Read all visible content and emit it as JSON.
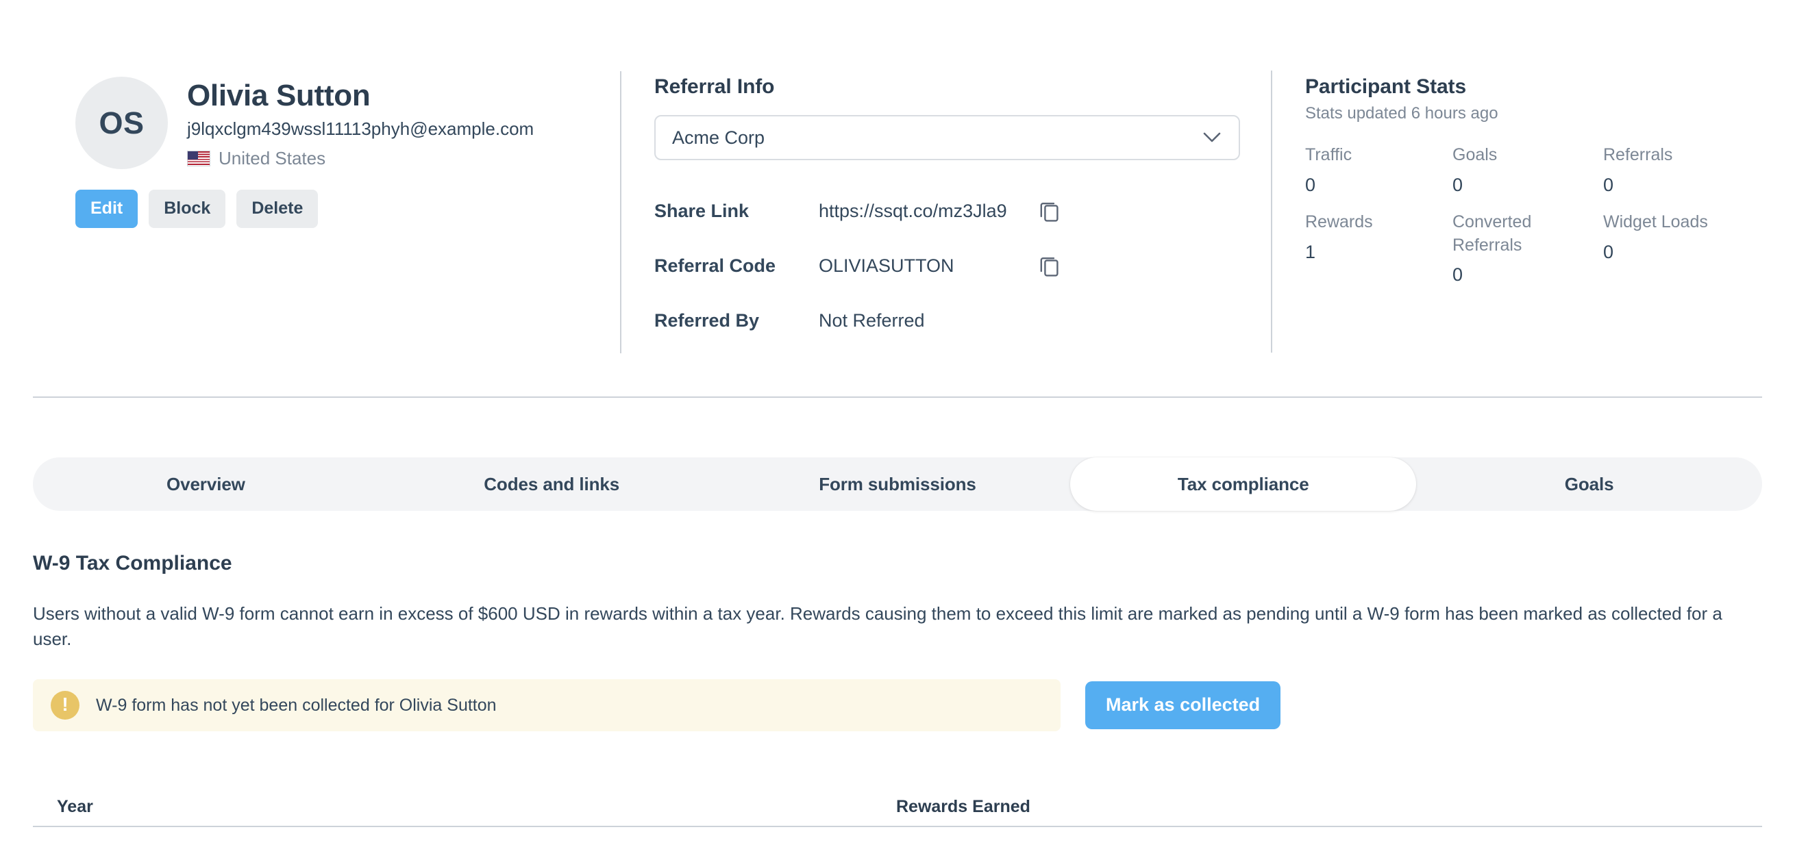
{
  "profile": {
    "initials": "OS",
    "name": "Olivia Sutton",
    "email": "j9lqxclgm439wssl11113phyh@example.com",
    "country": "United States",
    "flag": "🇺🇸",
    "buttons": {
      "edit": "Edit",
      "block": "Block",
      "delete": "Delete"
    }
  },
  "referral_info": {
    "title": "Referral Info",
    "program_select": {
      "value": "Acme Corp",
      "icon": "chevron-down-icon"
    },
    "rows": [
      {
        "label": "Share Link",
        "value": "https://ssqt.co/mz3Jla9",
        "copyable": true,
        "icon": "copy-icon"
      },
      {
        "label": "Referral Code",
        "value": "OLIVIASUTTON",
        "copyable": true,
        "icon": "copy-icon"
      },
      {
        "label": "Referred By",
        "value": "Not Referred",
        "copyable": false
      }
    ]
  },
  "participant_stats": {
    "title": "Participant Stats",
    "subtitle": "Stats updated 6 hours ago",
    "items": [
      {
        "label": "Traffic",
        "value": "0"
      },
      {
        "label": "Goals",
        "value": "0"
      },
      {
        "label": "Referrals",
        "value": "0"
      },
      {
        "label": "Rewards",
        "value": "1"
      },
      {
        "label": "Converted Referrals",
        "value": "0"
      },
      {
        "label": "Widget Loads",
        "value": "0"
      }
    ]
  },
  "tabs": [
    {
      "label": "Overview",
      "active": false
    },
    {
      "label": "Codes and links",
      "active": false
    },
    {
      "label": "Form submissions",
      "active": false
    },
    {
      "label": "Tax compliance",
      "active": true
    },
    {
      "label": "Goals",
      "active": false
    }
  ],
  "tax_compliance": {
    "heading": "W-9 Tax Compliance",
    "description": "Users without a valid W-9 form cannot earn in excess of $600 USD in rewards within a tax year. Rewards causing them to exceed this limit are marked as pending until a W-9 form has been marked as collected for a user.",
    "alert": {
      "icon": "warning-icon",
      "message": "W-9 form has not yet been collected for Olivia Sutton"
    },
    "mark_collected_label": "Mark as collected",
    "table": {
      "columns": [
        "Year",
        "Rewards Earned"
      ],
      "rows": []
    }
  },
  "colors": {
    "accent_blue": "#55aef1",
    "text_dark": "#2d3e50",
    "text_body": "#33475b",
    "text_muted": "#7c8795",
    "divider": "#cdd2d9",
    "tab_bar_bg": "#f3f4f6",
    "alert_bg": "#fcf8e8",
    "alert_icon": "#e8c567",
    "avatar_bg": "#eaecee",
    "button_secondary_bg": "#eaecee"
  }
}
